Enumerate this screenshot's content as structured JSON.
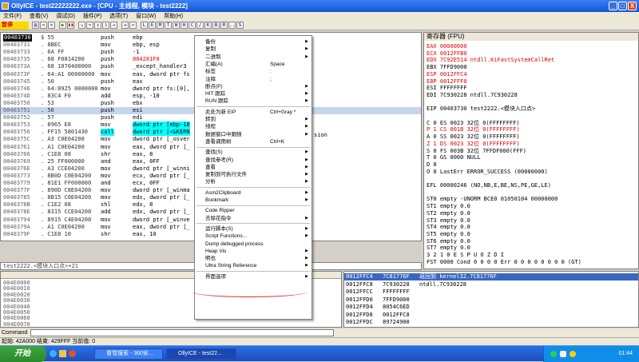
{
  "window": {
    "title": "OllyICE - test22222222.exe - [CPU - 主线程, 模块 - test2222]",
    "controls": [
      "_",
      "□",
      "X"
    ]
  },
  "menubar": [
    "文件(F)",
    "查看(V)",
    "调试(D)",
    "插件(P)",
    "选项(T)",
    "窗口(W)",
    "帮助(H)"
  ],
  "toolbar": {
    "status": "暂停",
    "letters": [
      "L",
      "E",
      "M",
      "T",
      "W",
      "H",
      "C",
      "/",
      "K",
      "B",
      "R",
      "...",
      "S"
    ]
  },
  "cpu": {
    "rows": [
      {
        "addr": "00403730",
        "hex": "$ 55",
        "mn": "push",
        "op": "ebp",
        "cur": true
      },
      {
        "addr": "00403731",
        "hex": ". 8BEC",
        "mn": "mov",
        "op": "ebp, esp"
      },
      {
        "addr": "00403733",
        "hex": ". 6A FF",
        "mn": "push",
        "op": "-1"
      },
      {
        "addr": "00403735",
        "hex": ". 68 F0814200",
        "mn": "push",
        "op": "004281F0",
        "red": true
      },
      {
        "addr": "0040373A",
        "hex": ". 68 1070400000",
        "mn": "push",
        "op": "_except_handler3"
      },
      {
        "addr": "0040373F",
        "hex": ". 64:A1 00000000",
        "mn": "mov",
        "op": "eax, dword ptr fs"
      },
      {
        "addr": "00403745",
        "hex": ". 50",
        "mn": "push",
        "op": "eax"
      },
      {
        "addr": "00403746",
        "hex": ". 64:8925 0000000",
        "mn": "mov",
        "op": "dword ptr fs:[0],"
      },
      {
        "addr": "0040374D",
        "hex": ". 83C4 F0",
        "mn": "add",
        "op": "esp, -10"
      },
      {
        "addr": "00403750",
        "hex": ". 53",
        "mn": "push",
        "op": "ebx"
      },
      {
        "addr": "00403751",
        "hex": ". 56",
        "mn": "push",
        "op": "esi",
        "hl": true
      },
      {
        "addr": "00403752",
        "hex": ". 57",
        "mn": "push",
        "op": "edi"
      },
      {
        "addr": "00403753",
        "hex": ". 8965 E8",
        "mn": "mov",
        "op": "dword ptr [ebp-18"
      },
      {
        "addr": "00403756",
        "hex": ". FF15 5801430",
        "mn": "call",
        "op": "dword ptr [<&KERN",
        "call": true
      },
      {
        "addr": "0040375C",
        "hex": ". A3 C0E04200",
        "mn": "mov",
        "op": "dword ptr [_osver"
      },
      {
        "addr": "00403761",
        "hex": ". A1 C0E04200",
        "mn": "mov",
        "op": "eax, dword ptr [_"
      },
      {
        "addr": "00403766",
        "hex": ". C1E8 08",
        "mn": "shr",
        "op": "eax, 8"
      },
      {
        "addr": "00403769",
        "hex": ". 25 FF000000",
        "mn": "and",
        "op": "eax, 0FF"
      },
      {
        "addr": "0040376E",
        "hex": ". A3 CCE04200",
        "mn": "mov",
        "op": "dword ptr [_winni"
      },
      {
        "addr": "00403773",
        "hex": ". 8B0D C0E04200",
        "mn": "mov",
        "op": "ecx, dword ptr [_"
      },
      {
        "addr": "00403779",
        "hex": ". 81E1 FF000000",
        "mn": "and",
        "op": "ecx, 0FF"
      },
      {
        "addr": "0040377F",
        "hex": ". 890D C8E04200",
        "mn": "mov",
        "op": "dword ptr [_winma"
      },
      {
        "addr": "00403785",
        "hex": ". 8B15 C0E04200",
        "mn": "mov",
        "op": "edx, dword ptr [_"
      },
      {
        "addr": "0040378B",
        "hex": ". C1E2 08",
        "mn": "shl",
        "op": "edx, 8"
      },
      {
        "addr": "0040378E",
        "hex": ". 8315 CCE04200",
        "mn": "add",
        "op": "edx, dword ptr [_"
      },
      {
        "addr": "00403794",
        "hex": ". 8915 C4E04200",
        "mn": "mov",
        "op": "dword ptr [_winve"
      },
      {
        "addr": "0040379A",
        "hex": ". A1 C0E04200",
        "mn": "mov",
        "op": "eax, dword ptr [_"
      },
      {
        "addr": "0040379F",
        "hex": ". C1E8 10",
        "mn": "shr",
        "op": "eax, 10"
      }
    ],
    "side_text": "sion"
  },
  "info_line": "test2222.<模块入口点>+21",
  "registers": {
    "title": "寄存器 (FPU)",
    "lines": [
      {
        "t": "EAX 00000000",
        "red": true
      },
      {
        "t": "ECX 0012FFB0",
        "red": true
      },
      {
        "t": "EDX 7C92E514 ntdll.KiFastSystemCallRet",
        "red": true
      },
      {
        "t": "EBX 7FFD9000"
      },
      {
        "t": "ESP 0012FFC4",
        "red": true
      },
      {
        "t": "EBP 0012FFF0",
        "red": true
      },
      {
        "t": "ESI FFFFFFFF"
      },
      {
        "t": "EDI 7C930228 ntdll.7C930228"
      },
      {
        "t": ""
      },
      {
        "t": "EIP 00403730 test2222.<模块入口点>"
      },
      {
        "t": ""
      },
      {
        "t": "C 0  ES 0023 32位 0(FFFFFFFF)"
      },
      {
        "t": "P 1  CS 001B 32位 0(FFFFFFFF)",
        "red": true
      },
      {
        "t": "A 0  SS 0023 32位 0(FFFFFFFF)"
      },
      {
        "t": "Z 1  DS 0023 32位 0(FFFFFFFF)",
        "red": true
      },
      {
        "t": "S 0  FS 003B 32位 7FFDF000(FFF)"
      },
      {
        "t": "T 0  GS 0000 NULL"
      },
      {
        "t": "D 0"
      },
      {
        "t": "O 0  LastErr ERROR_SUCCESS (00000000)"
      },
      {
        "t": ""
      },
      {
        "t": "EFL 00000246 (NO,NB,E,BE,NS,PE,GE,LE)"
      },
      {
        "t": ""
      },
      {
        "t": "ST0 empty -UNORM BCE0 01050104 00000000"
      },
      {
        "t": "ST1 empty 0.0"
      },
      {
        "t": "ST2 empty 0.0"
      },
      {
        "t": "ST3 empty 0.0"
      },
      {
        "t": "ST4 empty 0.0"
      },
      {
        "t": "ST5 empty 0.0"
      },
      {
        "t": "ST6 empty 0.0"
      },
      {
        "t": "ST7 empty 0.0"
      },
      {
        "t": "               3 2 1 0      E S P U O Z D I"
      },
      {
        "t": "FST 0000  Cond 0 0 0 0  Err 0 0 0 0 0 0 0 0  (GT)"
      }
    ]
  },
  "dump": {
    "rows": [
      "004E0000",
      "004E0010",
      "004E0020",
      "004E0030",
      "004E0040",
      "004E0050",
      "004E0060",
      "004E0070"
    ]
  },
  "stack": {
    "rows": [
      {
        "a": "0012FFC4",
        "v": "7C81776F",
        "c": "返回到 kernel32.7C81776F",
        "sel": true
      },
      {
        "a": "0012FFC8",
        "v": "7C930228",
        "c": "ntdll.7C930228"
      },
      {
        "a": "0012FFCC",
        "v": "FFFFFFFF",
        "c": ""
      },
      {
        "a": "0012FFD0",
        "v": "7FFD9000",
        "c": ""
      },
      {
        "a": "0012FFD4",
        "v": "8054C6ED",
        "c": ""
      },
      {
        "a": "0012FFD8",
        "v": "0012FFC8",
        "c": ""
      },
      {
        "a": "0012FFDC",
        "v": "89724900",
        "c": ""
      }
    ]
  },
  "context_menu": [
    {
      "label": "备份",
      "arrow": true
    },
    {
      "label": "复制",
      "arrow": true
    },
    {
      "label": "二进制",
      "arrow": true
    },
    {
      "label": "汇编(A)",
      "shortcut": "Space"
    },
    {
      "label": "标签",
      "shortcut": ":"
    },
    {
      "label": "注释",
      "shortcut": ";"
    },
    {
      "label": "断点(P)",
      "arrow": true
    },
    {
      "label": "HIT 跟踪",
      "arrow": true
    },
    {
      "label": "RUN 跟踪",
      "arrow": true
    },
    {
      "sep": true
    },
    {
      "label": "此处为新 EIP",
      "shortcut": "Ctrl+Gray *"
    },
    {
      "label": "转到",
      "arrow": true
    },
    {
      "label": "线程",
      "arrow": true
    },
    {
      "label": "数据窗口中跟随",
      "arrow": true
    },
    {
      "label": "查看调用树",
      "shortcut": "Ctrl+K"
    },
    {
      "sep": true
    },
    {
      "label": "查找(S)",
      "arrow": true
    },
    {
      "label": "查找参考(R)",
      "arrow": true
    },
    {
      "label": "查看",
      "arrow": true
    },
    {
      "label": "复制到可执行文件",
      "arrow": true
    },
    {
      "label": "分析",
      "arrow": true
    },
    {
      "sep": true
    },
    {
      "label": "Asm2Clipboard",
      "arrow": true
    },
    {
      "label": "Bookmark",
      "arrow": true
    },
    {
      "sep": true
    },
    {
      "label": "Code Ripper"
    },
    {
      "label": "去除花指令",
      "arrow": true
    },
    {
      "sep": true
    },
    {
      "label": "运行脚本(S)",
      "arrow": true
    },
    {
      "label": "Script Functions...",
      "arrow": true
    },
    {
      "label": "Dump debugged process"
    },
    {
      "label": "Heap Vis",
      "arrow": true
    },
    {
      "label": "明也",
      "arrow": true
    },
    {
      "label": "Ultra String Reference",
      "arrow": true
    },
    {
      "sep": true
    },
    {
      "label": "界面选项",
      "arrow": true
    }
  ],
  "command": {
    "label": "Command"
  },
  "status_bar": "起始: 42A000 结束: 429FFF 当前值: 0",
  "taskbar": {
    "start": "开始",
    "tasks": [
      "看雪搜索 - 360安...",
      "OllyICE - test22..."
    ],
    "clock": "01:44"
  }
}
